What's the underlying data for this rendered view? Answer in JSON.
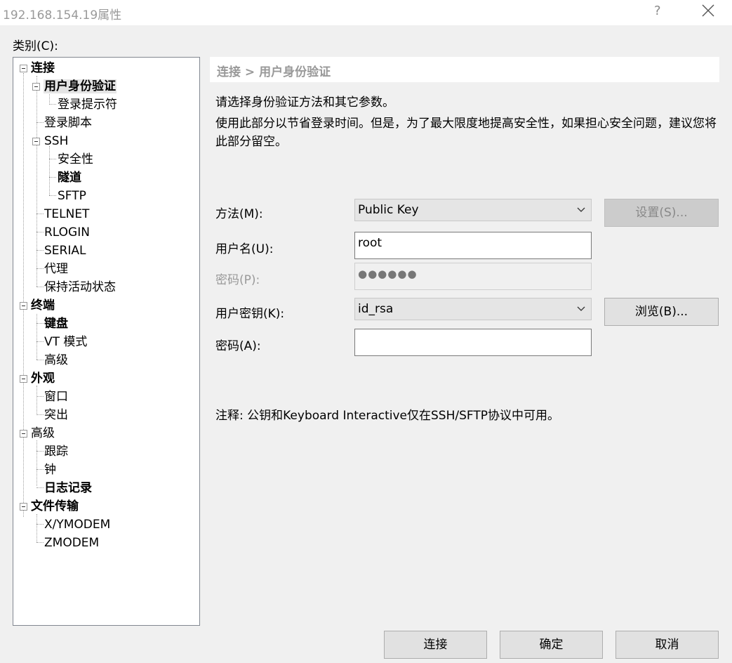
{
  "window": {
    "title": "192.168.154.19属性",
    "help": "?"
  },
  "category_label": "类别(C):",
  "tree": {
    "items": [
      {
        "label": "连接"
      },
      {
        "label": "用户身份验证"
      },
      {
        "label": "登录提示符"
      },
      {
        "label": "登录脚本"
      },
      {
        "label": "SSH"
      },
      {
        "label": "安全性"
      },
      {
        "label": "隧道"
      },
      {
        "label": "SFTP"
      },
      {
        "label": "TELNET"
      },
      {
        "label": "RLOGIN"
      },
      {
        "label": "SERIAL"
      },
      {
        "label": "代理"
      },
      {
        "label": "保持活动状态"
      },
      {
        "label": "终端"
      },
      {
        "label": "键盘"
      },
      {
        "label": "VT 模式"
      },
      {
        "label": "高级"
      },
      {
        "label": "外观"
      },
      {
        "label": "窗口"
      },
      {
        "label": "突出"
      },
      {
        "label": "高级"
      },
      {
        "label": "跟踪"
      },
      {
        "label": "钟"
      },
      {
        "label": "日志记录"
      },
      {
        "label": "文件传输"
      },
      {
        "label": "X/YMODEM"
      },
      {
        "label": "ZMODEM"
      }
    ]
  },
  "panel": {
    "breadcrumb": "连接 > 用户身份验证",
    "desc1": "请选择身份验证方法和其它参数。",
    "desc2": "使用此部分以节省登录时间。但是，为了最大限度地提高安全性，如果担心安全问题，建议您将此部分留空。",
    "method_label": "方法(M):",
    "method_value": "Public Key",
    "settings_button": "设置(S)...",
    "username_label": "用户名(U):",
    "username_value": "root",
    "password_label": "密码(P):",
    "password_value": "●●●●●●",
    "userkey_label": "用户密钥(K):",
    "userkey_value": "id_rsa",
    "browse_button": "浏览(B)...",
    "passphrase_label": "密码(A):",
    "passphrase_value": "",
    "note": "注释: 公钥和Keyboard Interactive仅在SSH/SFTP协议中可用。"
  },
  "footer": {
    "connect": "连接",
    "ok": "确定",
    "cancel": "取消"
  }
}
